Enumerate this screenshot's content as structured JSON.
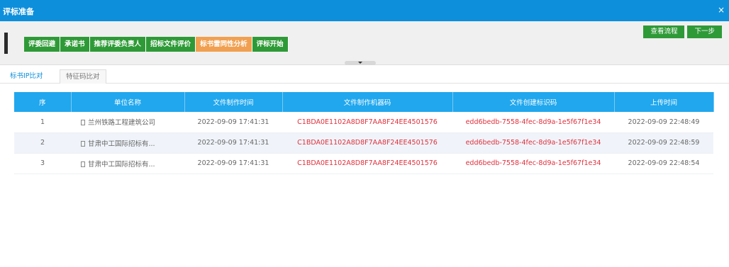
{
  "window": {
    "title": "评标准备",
    "close_icon": "close-icon"
  },
  "steps": [
    {
      "label": "评委回避",
      "active": false
    },
    {
      "label": "承诺书",
      "active": false
    },
    {
      "label": "推荐评委负责人",
      "active": false
    },
    {
      "label": "招标文件评价",
      "active": false
    },
    {
      "label": "标书雷同性分析",
      "active": true
    },
    {
      "label": "评标开始",
      "active": false
    }
  ],
  "actions": {
    "view_flow": "查看流程",
    "next": "下一步"
  },
  "tabs": [
    "标书IP比对",
    "特征码比对"
  ],
  "table": {
    "headers": [
      "序",
      "单位名称",
      "文件制作时间",
      "文件制作机器码",
      "文件创建标识码",
      "上传时间"
    ],
    "rows": [
      {
        "no": "1",
        "unit": "兰州铁路工程建筑公司",
        "made_time": "2022-09-09 17:41:31",
        "machine_code": "C1BDA0E1102A8D8F7AA8F24EE4501576",
        "create_id": "edd6bedb-7558-4fec-8d9a-1e5f67f1e34",
        "upload_time": "2022-09-09 22:48:49"
      },
      {
        "no": "2",
        "unit": "甘肃中工国际招标有...",
        "made_time": "2022-09-09 17:41:31",
        "machine_code": "C1BDA0E1102A8D8F7AA8F24EE4501576",
        "create_id": "edd6bedb-7558-4fec-8d9a-1e5f67f1e34",
        "upload_time": "2022-09-09 22:48:59"
      },
      {
        "no": "3",
        "unit": "甘肃中工国际招标有...",
        "made_time": "2022-09-09 17:41:31",
        "machine_code": "C1BDA0E1102A8D8F7AA8F24EE4501576",
        "create_id": "edd6bedb-7558-4fec-8d9a-1e5f67f1e34",
        "upload_time": "2022-09-09 22:48:54"
      }
    ]
  },
  "colors": {
    "titlebar": "#0d8fdb",
    "step": "#2e9a37",
    "step_active": "#f0a050",
    "table_header": "#20a7ee",
    "highlight_text": "#e0303c"
  }
}
